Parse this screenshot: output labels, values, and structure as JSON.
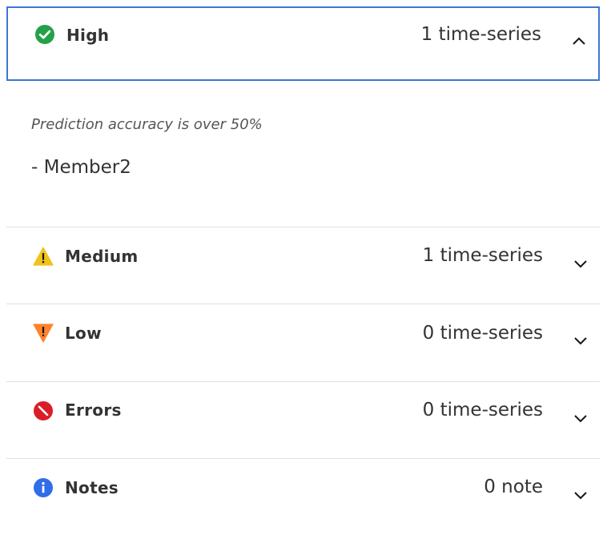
{
  "accordion": {
    "high": {
      "label": "High",
      "count": "1 time-series",
      "icon": "check-circle-icon",
      "icon_color": "#24a148",
      "expanded": true,
      "description": "Prediction accuracy is over 50%",
      "members": [
        "- Member2"
      ]
    },
    "medium": {
      "label": "Medium",
      "count": "1 time-series",
      "icon": "warning-triangle-icon",
      "icon_color": "#f1c21b",
      "expanded": false
    },
    "low": {
      "label": "Low",
      "count": "0 time-series",
      "icon": "warning-down-triangle-icon",
      "icon_color": "#ff832b",
      "expanded": false
    },
    "errors": {
      "label": "Errors",
      "count": "0 time-series",
      "icon": "error-circle-icon",
      "icon_color": "#da1e28",
      "expanded": false
    },
    "notes": {
      "label": "Notes",
      "count": "0 note",
      "icon": "info-circle-icon",
      "icon_color": "#2f6ee8",
      "expanded": false
    }
  },
  "colors": {
    "focus_border": "#3d76d6",
    "divider": "#e0e0e0"
  }
}
